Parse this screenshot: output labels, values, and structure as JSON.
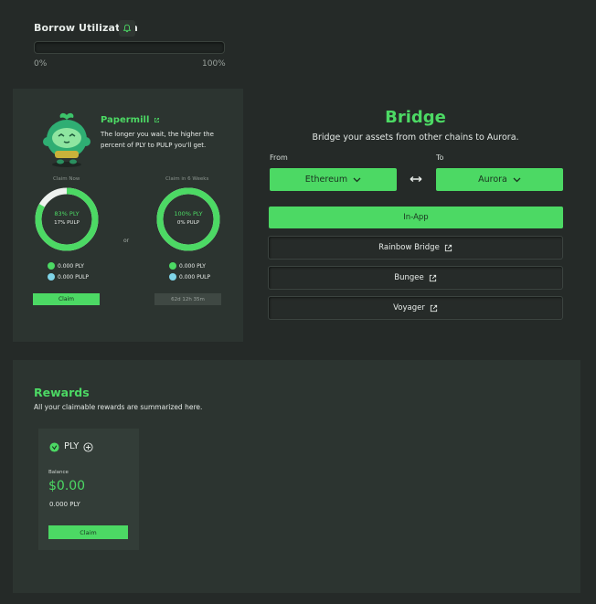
{
  "borrow": {
    "title": "Borrow Utilization",
    "utilization_percent": 0,
    "min_label": "0%",
    "max_label": "100%"
  },
  "papermill": {
    "title": "Papermill",
    "description": "The longer you wait, the higher the percent of PLY to PULP you'll get.",
    "claim_now": {
      "label": "Claim Now",
      "ply_percent": "83% PLY",
      "pulp_percent": "17% PULP",
      "ply_fraction": 0.83,
      "ply_amount": "0.000 PLY",
      "pulp_amount": "0.000 PULP",
      "button": "Claim"
    },
    "or": "or",
    "claim_weeks": {
      "label": "Claim in 6 Weeks",
      "ply_percent": "100% PLY",
      "pulp_percent": "0% PULP",
      "ply_fraction": 1.0,
      "ply_amount": "0.000 PLY",
      "pulp_amount": "0.000 PULP",
      "countdown": "62d 12h 35m"
    }
  },
  "bridge": {
    "title": "Bridge",
    "subtitle": "Bridge your assets from other chains to Aurora.",
    "from_label": "From",
    "to_label": "To",
    "from_value": "Ethereum",
    "to_value": "Aurora",
    "inapp": "In-App",
    "rainbow": "Rainbow Bridge",
    "bungee": "Bungee",
    "voyager": "Voyager"
  },
  "rewards": {
    "title": "Rewards",
    "subtitle": "All your claimable rewards are summarized here.",
    "token": "PLY",
    "balance_label": "Balance",
    "balance_value": "$0.00",
    "balance_amount": "0.000 PLY",
    "claim": "Claim"
  },
  "colors": {
    "accent": "#4cd964",
    "background": "#252a28",
    "card": "#2c3430"
  }
}
